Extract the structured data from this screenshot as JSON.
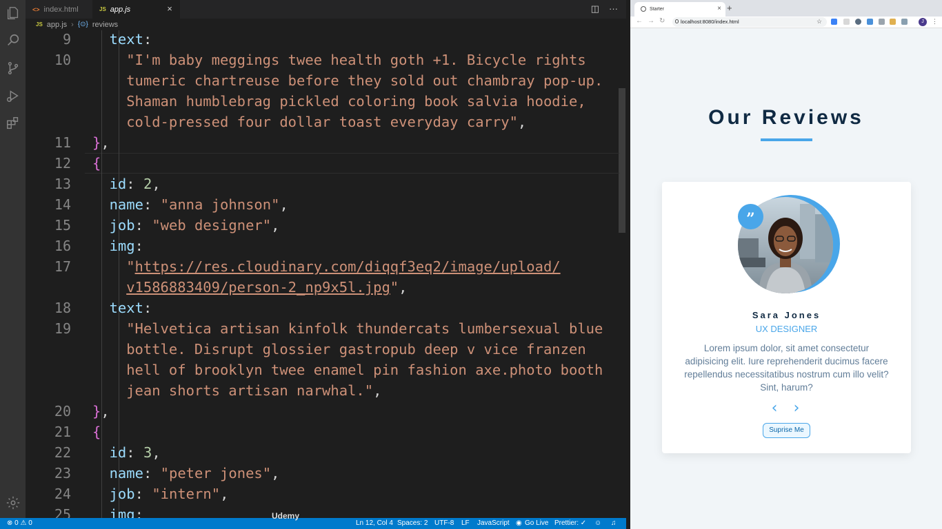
{
  "vscode": {
    "tabs": [
      {
        "label": "index.html",
        "icon": "html-file-icon"
      },
      {
        "label": "app.js",
        "icon": "js-file-icon"
      }
    ],
    "breadcrumb": {
      "file": "app.js",
      "symbol": "reviews"
    },
    "line_numbers": [
      "9",
      "10",
      "",
      "",
      "",
      "11",
      "12",
      "13",
      "14",
      "15",
      "16",
      "17",
      "",
      "18",
      "19",
      "",
      "",
      "",
      "20",
      "21",
      "22",
      "23",
      "24",
      "25"
    ],
    "code_lines": [
      "text:",
      "\"I'm baby meggings twee health goth +1. Bicycle rights",
      "tumeric chartreuse before they sold out chambray pop-up.",
      "Shaman humblebrag pickled coloring book salvia hoodie,",
      "cold-pressed four dollar toast everyday carry\",",
      "},",
      "{",
      "id: 2,",
      "name: \"anna johnson\",",
      "job: \"web designer\",",
      "img:",
      "\"https://res.cloudinary.com/diqqf3eq2/image/upload/",
      "v1586883409/person-2_np9x5l.jpg\",",
      "text:",
      "\"Helvetica artisan kinfolk thundercats lumbersexual blue",
      "bottle. Disrupt glossier gastropub deep v vice franzen",
      "hell of brooklyn twee enamel pin fashion axe.photo booth",
      "jean shorts artisan narwhal.\",",
      "},",
      "{",
      "id: 3,",
      "name: \"peter jones\",",
      "job: \"intern\",",
      "img:"
    ],
    "status": {
      "errors": "0",
      "warnings": "0",
      "position": "Ln 12, Col 4",
      "spaces": "Spaces: 2",
      "encoding": "UTF-8",
      "eol": "LF",
      "language": "JavaScript",
      "golive": "Go Live",
      "prettier": "Prettier: ✓"
    }
  },
  "browser": {
    "tab_title": "Starter",
    "url": "localhost:8080/index.html",
    "avatar_letter": "J",
    "page": {
      "title": "Our Reviews",
      "author": "Sara Jones",
      "job": "UX DESIGNER",
      "info": "Lorem ipsum dolor, sit amet consectetur adipisicing elit. Iure reprehenderit ducimus facere repellendus necessitatibus nostrum cum illo velit? Sint, harum?",
      "prev_symbol": "‹",
      "next_symbol": "›",
      "surprise_label": "Suprise Me",
      "quote_symbol": "”"
    }
  },
  "watermark": "Udemy",
  "colors": {
    "accent": "#49a6e9",
    "title": "#102a43",
    "statusbar": "#007acc"
  }
}
